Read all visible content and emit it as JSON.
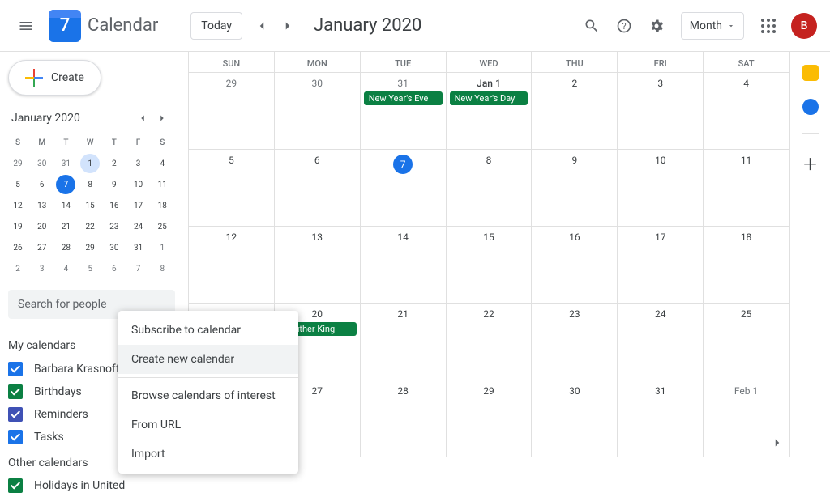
{
  "header": {
    "logo_day": "7",
    "app_title": "Calendar",
    "today_label": "Today",
    "month_title": "January 2020",
    "view_label": "Month",
    "avatar_initial": "B"
  },
  "sidebar": {
    "create_label": "Create",
    "mini_title": "January 2020",
    "mini_headers": [
      "S",
      "M",
      "T",
      "W",
      "T",
      "F",
      "S"
    ],
    "mini_days": [
      {
        "n": "29",
        "dim": true
      },
      {
        "n": "30",
        "dim": true
      },
      {
        "n": "31",
        "dim": true
      },
      {
        "n": "1",
        "light": true
      },
      {
        "n": "2"
      },
      {
        "n": "3"
      },
      {
        "n": "4"
      },
      {
        "n": "5"
      },
      {
        "n": "6"
      },
      {
        "n": "7",
        "today": true
      },
      {
        "n": "8"
      },
      {
        "n": "9"
      },
      {
        "n": "10"
      },
      {
        "n": "11"
      },
      {
        "n": "12"
      },
      {
        "n": "13"
      },
      {
        "n": "14"
      },
      {
        "n": "15"
      },
      {
        "n": "16"
      },
      {
        "n": "17"
      },
      {
        "n": "18"
      },
      {
        "n": "19"
      },
      {
        "n": "20"
      },
      {
        "n": "21"
      },
      {
        "n": "22"
      },
      {
        "n": "23"
      },
      {
        "n": "24"
      },
      {
        "n": "25"
      },
      {
        "n": "26"
      },
      {
        "n": "27"
      },
      {
        "n": "28"
      },
      {
        "n": "29"
      },
      {
        "n": "30"
      },
      {
        "n": "31"
      },
      {
        "n": "1",
        "dim": true
      },
      {
        "n": "2",
        "dim": true
      },
      {
        "n": "3",
        "dim": true
      },
      {
        "n": "4",
        "dim": true
      },
      {
        "n": "5",
        "dim": true
      },
      {
        "n": "6",
        "dim": true
      },
      {
        "n": "7",
        "dim": true
      },
      {
        "n": "8",
        "dim": true
      }
    ],
    "search_placeholder": "Search for people",
    "my_cal_label": "My calendars",
    "other_cal_label": "Other calendars",
    "my_calendars": [
      {
        "label": "Barbara Krasnoff",
        "color": "chk-blue"
      },
      {
        "label": "Birthdays",
        "color": "chk-green"
      },
      {
        "label": "Reminders",
        "color": "chk-dblue"
      },
      {
        "label": "Tasks",
        "color": "chk-blue"
      }
    ],
    "other_calendars": [
      {
        "label": "Holidays in United",
        "color": "chk-green"
      }
    ]
  },
  "grid": {
    "headers": [
      "SUN",
      "MON",
      "TUE",
      "WED",
      "THU",
      "FRI",
      "SAT"
    ],
    "weeks": [
      [
        {
          "n": "29",
          "dim": true
        },
        {
          "n": "30",
          "dim": true
        },
        {
          "n": "31",
          "dim": true,
          "events": [
            "New Year's Eve"
          ]
        },
        {
          "n": "Jan 1",
          "bold": true,
          "events": [
            "New Year's Day"
          ]
        },
        {
          "n": "2"
        },
        {
          "n": "3"
        },
        {
          "n": "4"
        }
      ],
      [
        {
          "n": "5"
        },
        {
          "n": "6"
        },
        {
          "n": "7",
          "today": true
        },
        {
          "n": "8"
        },
        {
          "n": "9"
        },
        {
          "n": "10"
        },
        {
          "n": "11"
        }
      ],
      [
        {
          "n": "12"
        },
        {
          "n": "13"
        },
        {
          "n": "14"
        },
        {
          "n": "15"
        },
        {
          "n": "16"
        },
        {
          "n": "17"
        },
        {
          "n": "18"
        }
      ],
      [
        {
          "n": ""
        },
        {
          "n": "20",
          "events": [
            "n Luther King"
          ]
        },
        {
          "n": "21"
        },
        {
          "n": "22"
        },
        {
          "n": "23"
        },
        {
          "n": "24"
        },
        {
          "n": "25"
        }
      ],
      [
        {
          "n": ""
        },
        {
          "n": "27"
        },
        {
          "n": "28"
        },
        {
          "n": "29"
        },
        {
          "n": "30"
        },
        {
          "n": "31"
        },
        {
          "n": "Feb 1",
          "dim": true
        }
      ]
    ]
  },
  "context_menu": {
    "items": [
      {
        "label": "Subscribe to calendar"
      },
      {
        "label": "Create new calendar",
        "hover": true,
        "divider_after": true
      },
      {
        "label": "Browse calendars of interest"
      },
      {
        "label": "From URL"
      },
      {
        "label": "Import"
      }
    ]
  }
}
